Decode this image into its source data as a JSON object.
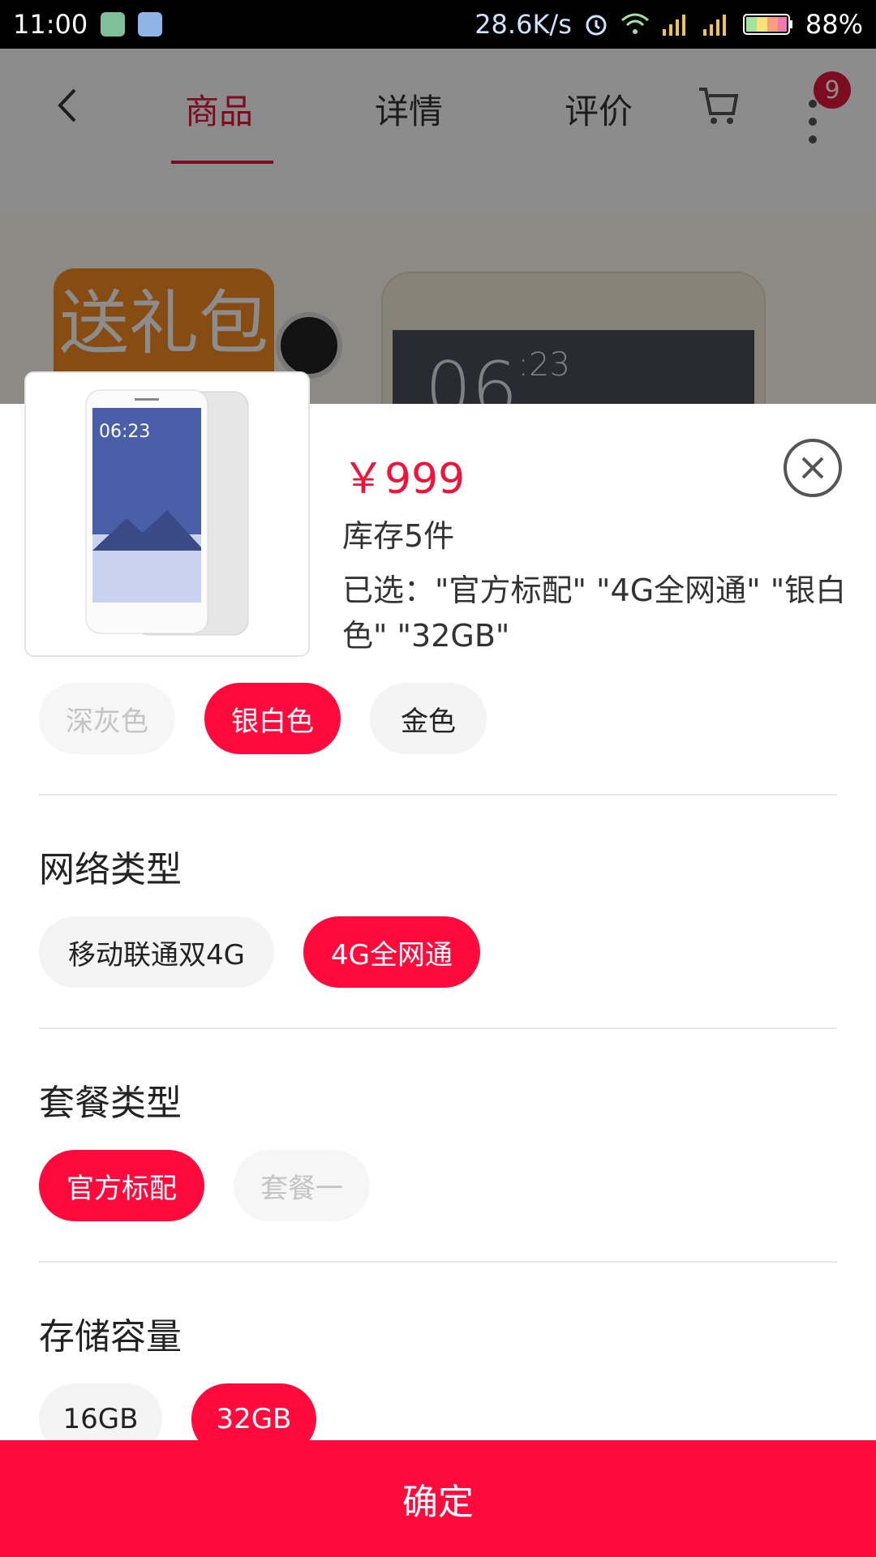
{
  "status_bar": {
    "time": "11:00",
    "net_speed": "28.6K/s",
    "battery": "88%",
    "icons": [
      "shield-app-icon",
      "gallery-app-icon",
      "alarm-icon",
      "wifi-icon",
      "signal-icon",
      "signal-icon",
      "battery-icon"
    ]
  },
  "background_page": {
    "tabs": [
      {
        "label": "商品",
        "active": true
      },
      {
        "label": "详情",
        "active": false
      },
      {
        "label": "评价",
        "active": false
      }
    ],
    "cart_badge": "9",
    "promo_text": "送礼包",
    "accent_color": "#e5173b"
  },
  "sku_sheet": {
    "price": "￥999",
    "stock": "库存5件",
    "selected": "已选：\"官方标配\" \"4G全网通\" \"银白色\" \"32GB\"",
    "color_options": [
      {
        "label": "深灰色",
        "state": "disabled"
      },
      {
        "label": "银白色",
        "state": "active"
      },
      {
        "label": "金色",
        "state": "normal"
      }
    ],
    "network": {
      "title": "网络类型",
      "options": [
        {
          "label": "移动联通双4G",
          "state": "normal"
        },
        {
          "label": "4G全网通",
          "state": "active"
        }
      ]
    },
    "package": {
      "title": "套餐类型",
      "options": [
        {
          "label": "官方标配",
          "state": "active"
        },
        {
          "label": "套餐一",
          "state": "disabled"
        }
      ]
    },
    "storage": {
      "title": "存储容量",
      "options": [
        {
          "label": "16GB",
          "state": "normal"
        },
        {
          "label": "32GB",
          "state": "active"
        }
      ]
    },
    "confirm_label": "确定",
    "active_color": "#ff0a3c"
  }
}
